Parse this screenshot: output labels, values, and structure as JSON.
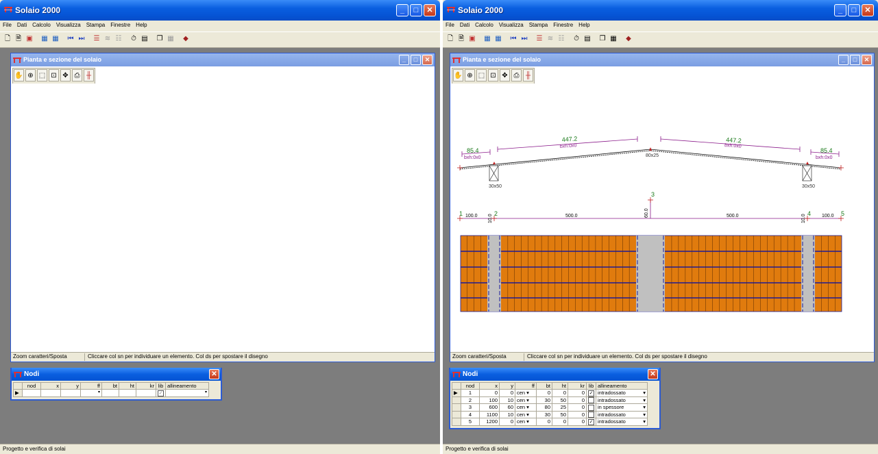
{
  "app": {
    "title": "Solaio 2000",
    "menu": [
      "File",
      "Dati",
      "Calcolo",
      "Visualizza",
      "Stampa",
      "Finestre",
      "Help"
    ],
    "status": "Progetto e verifica di solai",
    "toolbar_icons": [
      "new-icon",
      "open-icon",
      "save-icon",
      "sep",
      "grid-icon",
      "grid2-icon",
      "sep",
      "first-icon",
      "last-icon",
      "sep",
      "beam-icon",
      "load-icon",
      "frame-icon",
      "sep",
      "timer-icon",
      "report-icon",
      "sep",
      "copy-icon",
      "calc-icon",
      "sep",
      "book-icon"
    ]
  },
  "child": {
    "title": "Pianta e sezione del solaio",
    "tools": [
      "hand-icon",
      "zoom-in-icon",
      "zoom-window-icon",
      "zoom-select-icon",
      "move-icon",
      "print-icon",
      "settings-icon"
    ],
    "status_left": "Zoom caratteri/Sposta",
    "status_hint": "Cliccare col sn per individuare un elemento. Col ds per spostare il disegno"
  },
  "nodi": {
    "title": "Nodi",
    "columns": [
      "nod",
      "x",
      "y",
      "ff",
      "bt",
      "ht",
      "kr",
      "lib",
      "allineamento"
    ],
    "rows": [
      {
        "nod": "1",
        "x": "0",
        "y": "0",
        "ff": "cen",
        "bt": "0",
        "ht": "0",
        "kr": "0",
        "lib": true,
        "all": "intradossato"
      },
      {
        "nod": "2",
        "x": "100",
        "y": "10",
        "ff": "cen",
        "bt": "30",
        "ht": "50",
        "kr": "0",
        "lib": false,
        "all": "intradossato"
      },
      {
        "nod": "3",
        "x": "600",
        "y": "60",
        "ff": "cen",
        "bt": "80",
        "ht": "25",
        "kr": "0",
        "lib": false,
        "all": "in spessore"
      },
      {
        "nod": "4",
        "x": "1100",
        "y": "10",
        "ff": "cen",
        "bt": "30",
        "ht": "50",
        "kr": "0",
        "lib": false,
        "all": "intradossato"
      },
      {
        "nod": "5",
        "x": "1200",
        "y": "0",
        "ff": "cen",
        "bt": "0",
        "ht": "0",
        "kr": "0",
        "lib": true,
        "all": "intradossato"
      }
    ]
  },
  "drawing": {
    "dims_top": [
      "85.4",
      "bxh:0x0",
      "447.2",
      "bxh:0x0",
      "447.2",
      "bxh:0x0",
      "85.4",
      "bxh:0x0"
    ],
    "col_labels": [
      "30x50",
      "80x25",
      "30x50"
    ],
    "node_labels": [
      "1",
      "2",
      "3",
      "4",
      "5"
    ],
    "spans": [
      "100.0",
      "500.0",
      "500.0",
      "100.0"
    ],
    "heights": [
      "10.0",
      "60.0",
      "10.0"
    ],
    "colors": {
      "tile": "#e07b0e",
      "line": "#1a1a9a",
      "dim": "#8a1a8a",
      "label": "#1a7a1a",
      "beam": "#c0c0c0"
    }
  }
}
